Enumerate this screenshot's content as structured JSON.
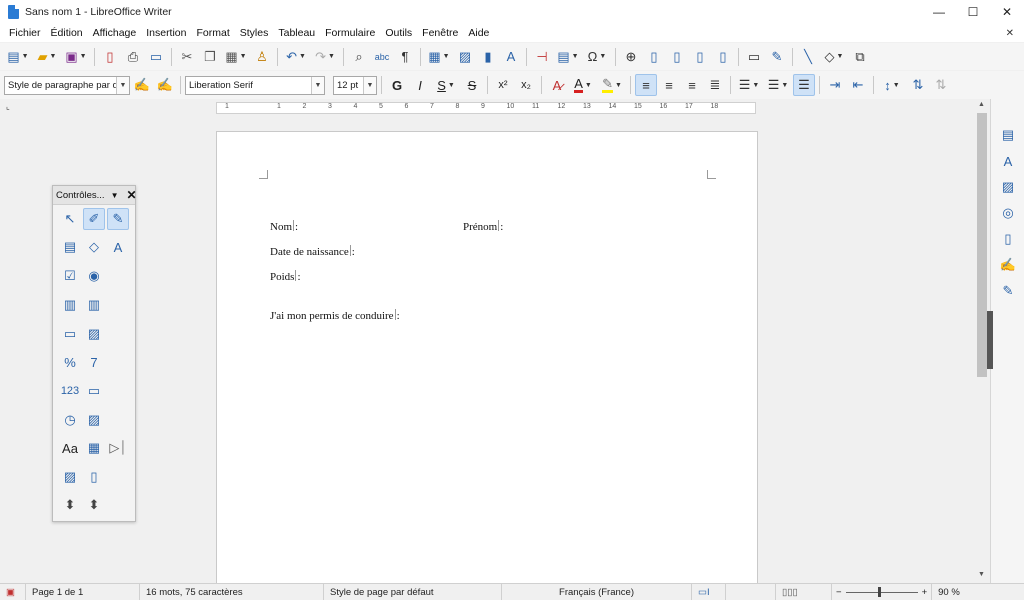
{
  "window": {
    "title": "Sans nom 1 - LibreOffice Writer",
    "minimize": "—",
    "maximize": "☐",
    "close": "✕"
  },
  "menu": {
    "items": [
      "Fichier",
      "Édition",
      "Affichage",
      "Insertion",
      "Format",
      "Styles",
      "Tableau",
      "Formulaire",
      "Outils",
      "Fenêtre",
      "Aide"
    ],
    "close": "✕"
  },
  "formatting": {
    "paragraph_style": "Style de paragraphe par défaut",
    "font_name": "Liberation Serif",
    "font_size": "12 pt",
    "bold": "G",
    "italic": "I",
    "underline": "S",
    "strike": "S",
    "superscript": "x²",
    "subscript": "x₂"
  },
  "ruler": {
    "marks": [
      "1",
      "1",
      "2",
      "3",
      "4",
      "5",
      "6",
      "7",
      "8",
      "9",
      "10",
      "11",
      "12",
      "13",
      "14",
      "15",
      "16",
      "17",
      "18"
    ]
  },
  "document": {
    "lines": [
      {
        "label": "Nom",
        "suffix": ":"
      },
      {
        "label": "Prénom",
        "suffix": ":"
      },
      {
        "label": "Date de naissance",
        "suffix": ":"
      },
      {
        "label": "Poids",
        "suffix": ":"
      },
      {
        "label": "J'ai mon permis de conduire",
        "suffix": ":"
      }
    ]
  },
  "controls_panel": {
    "title": "Contrôles...",
    "number_label": "123",
    "aa_label": "Aa"
  },
  "status": {
    "page": "Page 1 de 1",
    "words": "16 mots, 75 caractères",
    "page_style": "Style de page par défaut",
    "language": "Français (France)",
    "zoom": "90 %"
  },
  "colors": {
    "accent": "#2b63a8",
    "active_bg": "#cfe2f7",
    "font_color_red": "#d62020",
    "highlight_yellow": "#ffee00"
  }
}
